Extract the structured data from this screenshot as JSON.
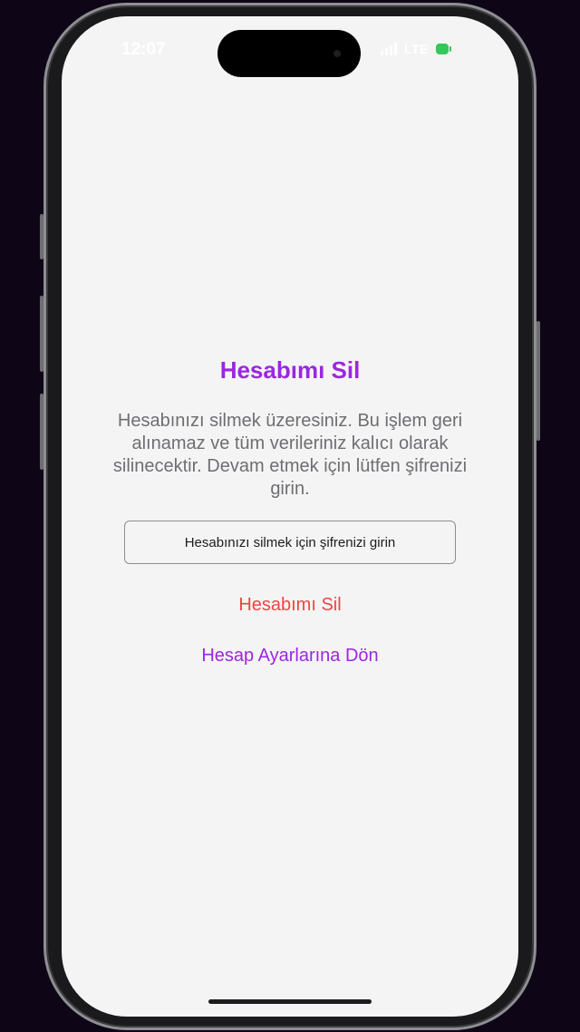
{
  "status_bar": {
    "time": "12:07",
    "network": "LTE",
    "signal_icon": "signal-bars-icon",
    "battery_icon": "battery-charging-icon",
    "battery_color": "#34c759"
  },
  "main": {
    "title": "Hesabımı Sil",
    "description": "Hesabınızı silmek üzeresiniz. Bu işlem geri alınamaz ve tüm verileriniz kalıcı olarak silinecektir. Devam etmek için lütfen şifrenizi girin.",
    "password_field": {
      "value": "",
      "placeholder": "Hesabınızı silmek için şifrenizi girin"
    },
    "delete_button_label": "Hesabımı Sil",
    "back_button_label": "Hesap Ayarlarına Dön"
  },
  "colors": {
    "accent": "#9b27e0",
    "danger": "#ef4444",
    "background": "#f4f4f4",
    "text_secondary": "#6e6e73"
  }
}
